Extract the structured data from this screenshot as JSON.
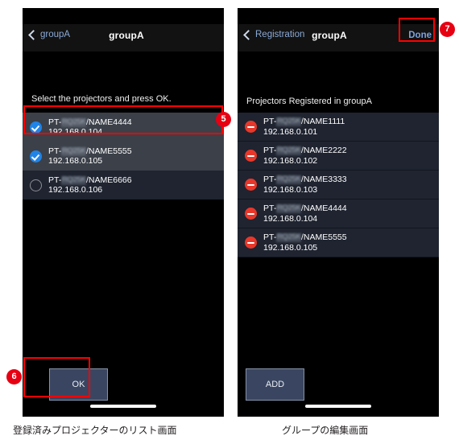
{
  "left_screen": {
    "navbar": {
      "back_label": "groupA",
      "back_icon": "chevron-left-icon",
      "title": "groupA"
    },
    "instruction": "Select the projectors and press OK.",
    "projectors": [
      {
        "state_icon": "checkbox-checked-icon",
        "name_prefix": "PT-",
        "model_redacted": "RQ25K",
        "name_suffix": "/NAME4444",
        "ip": "192.168.0.104",
        "selected": "true",
        "row_style": "sel-light"
      },
      {
        "state_icon": "checkbox-checked-icon",
        "name_prefix": "PT-",
        "model_redacted": "RQ25K",
        "name_suffix": "/NAME5555",
        "ip": "192.168.0.105",
        "selected": "true",
        "row_style": "sel-light"
      },
      {
        "state_icon": "checkbox-unchecked-icon",
        "name_prefix": "PT-",
        "model_redacted": "RQ25K",
        "name_suffix": "/NAME6666",
        "ip": "192.168.0.106",
        "selected": "false",
        "row_style": "sel-dark"
      }
    ],
    "ok_button_label": "OK",
    "caption": "登録済みプロジェクターのリスト画面"
  },
  "right_screen": {
    "navbar": {
      "back_label": "Registration",
      "back_icon": "chevron-left-icon",
      "title": "groupA",
      "done_label": "Done"
    },
    "list_header": "Projectors Registered in groupA",
    "projectors": [
      {
        "state_icon": "delete-minus-icon",
        "name_prefix": "PT-",
        "model_redacted": "RQ25K",
        "name_suffix": "/NAME1111",
        "ip": "192.168.0.101"
      },
      {
        "state_icon": "delete-minus-icon",
        "name_prefix": "PT-",
        "model_redacted": "RQ25K",
        "name_suffix": "/NAME2222",
        "ip": "192.168.0.102"
      },
      {
        "state_icon": "delete-minus-icon",
        "name_prefix": "PT-",
        "model_redacted": "RQ25K",
        "name_suffix": "/NAME3333",
        "ip": "192.168.0.103"
      },
      {
        "state_icon": "delete-minus-icon",
        "name_prefix": "PT-",
        "model_redacted": "RQ25K",
        "name_suffix": "/NAME4444",
        "ip": "192.168.0.104"
      },
      {
        "state_icon": "delete-minus-icon",
        "name_prefix": "PT-",
        "model_redacted": "RQ25K",
        "name_suffix": "/NAME5555",
        "ip": "192.168.0.105"
      }
    ],
    "add_button_label": "ADD",
    "caption": "グループの編集画面"
  },
  "callouts": {
    "five": "⑥",
    "six": "⑥",
    "seven": "⑦",
    "five_num": "5",
    "six_num": "6",
    "seven_num": "7"
  },
  "colors": {
    "highlight": "#ff0000",
    "callout_bg": "#e60012",
    "accent_blue": "#1f84e8",
    "delete_red": "#e8372a",
    "button_fill": "#3a4661",
    "row_selected": "#3b4049",
    "row_dark": "#1f2430"
  }
}
